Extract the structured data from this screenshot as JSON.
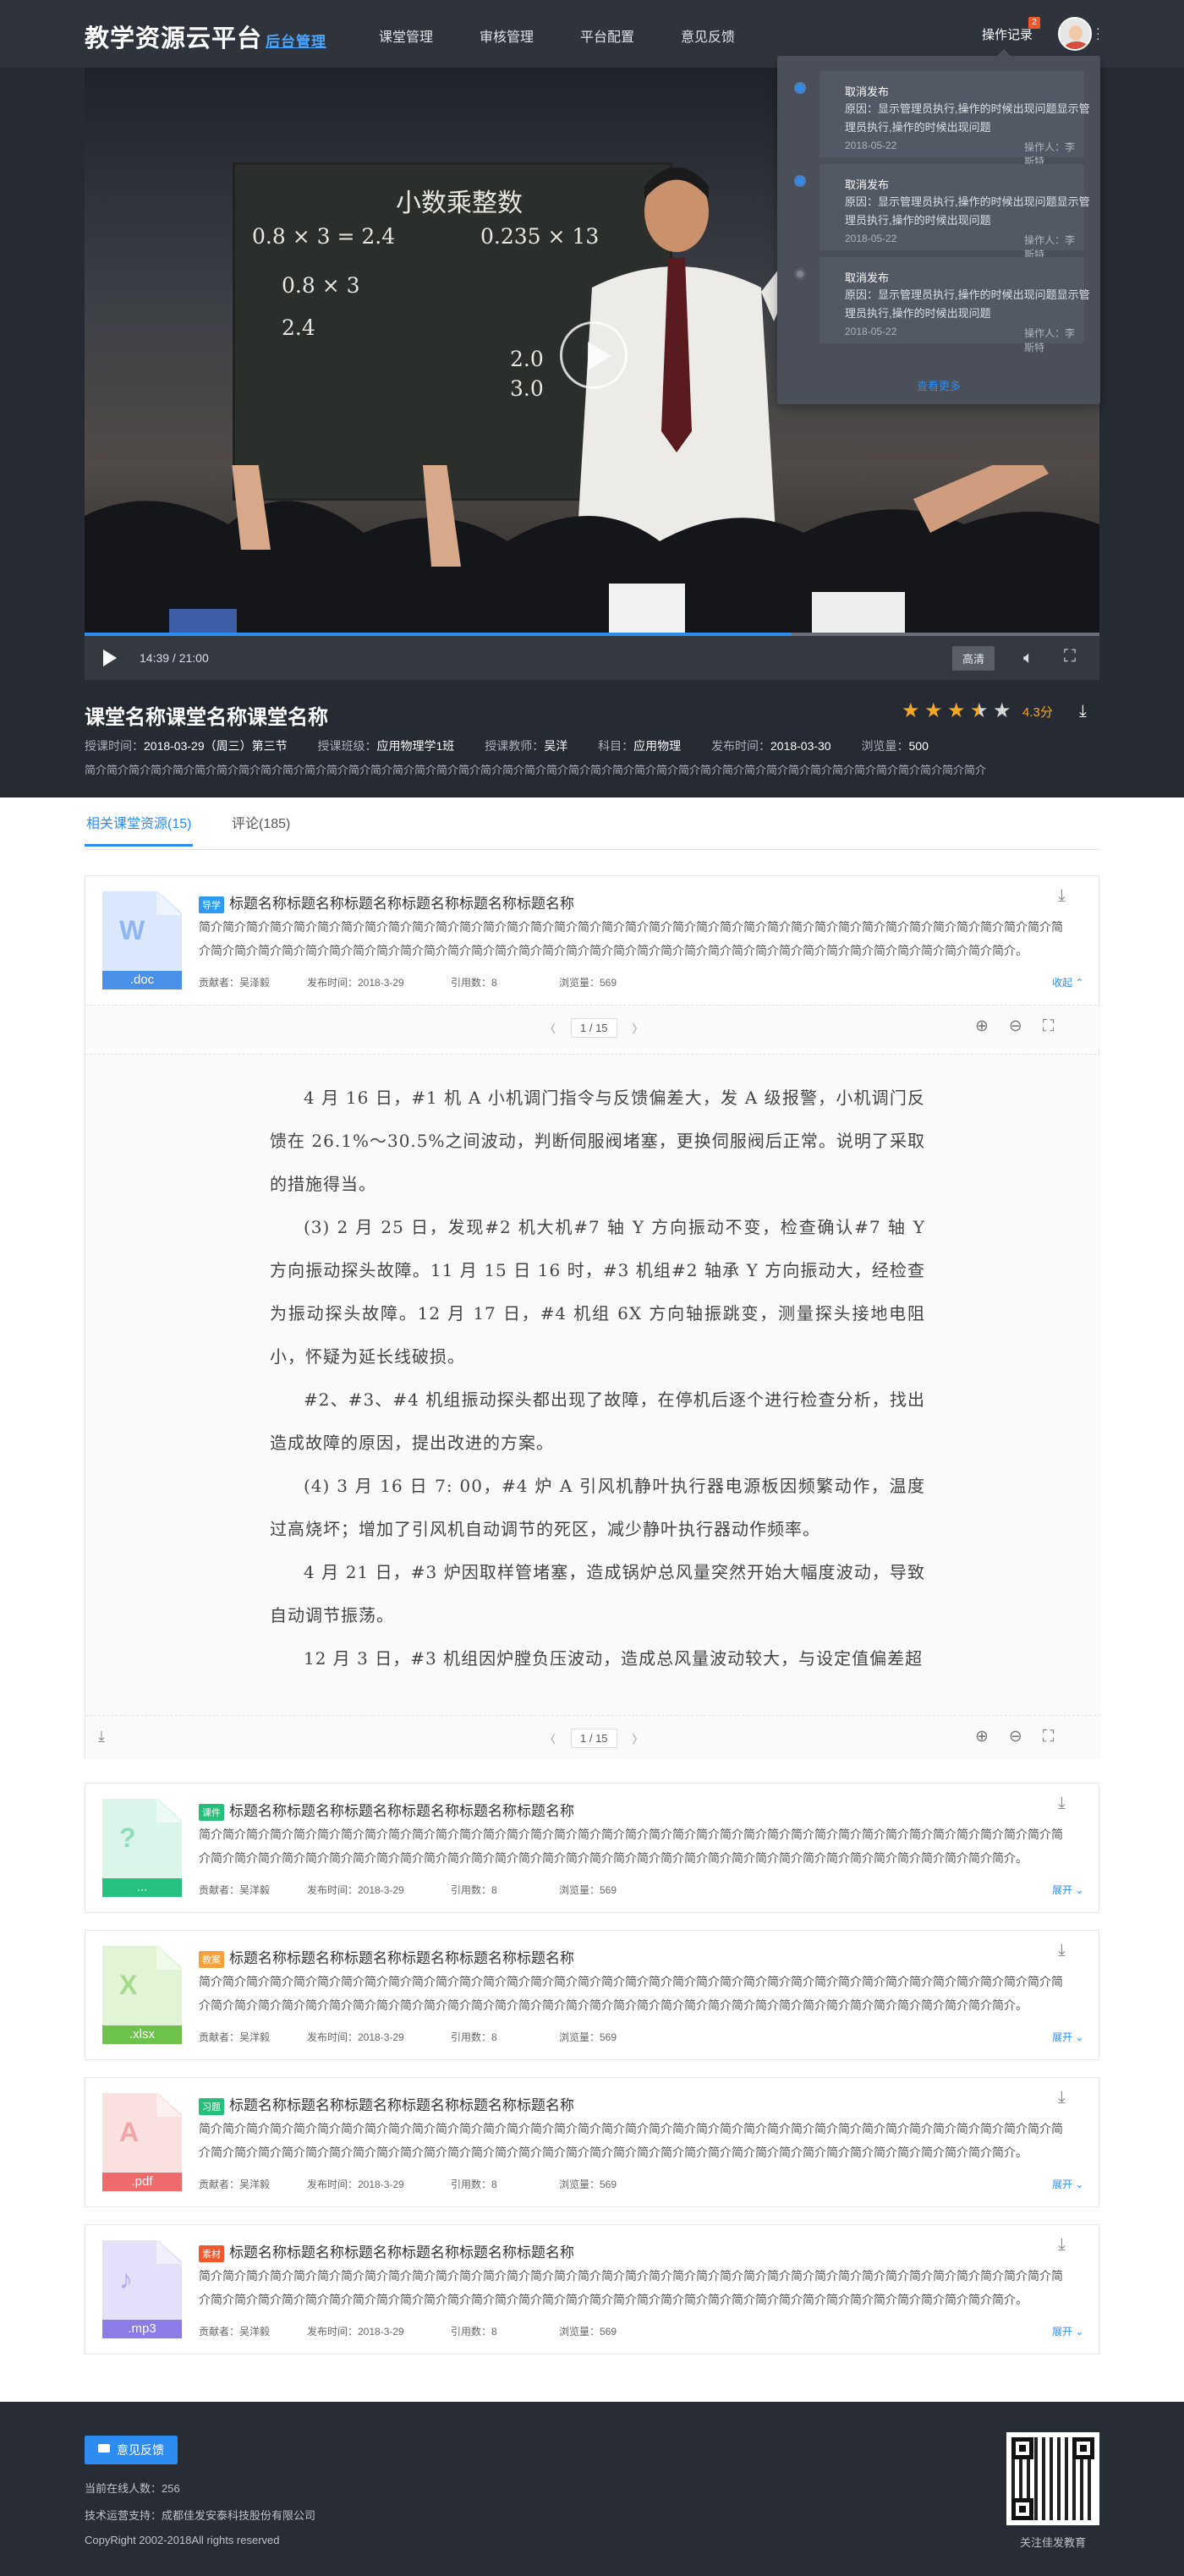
{
  "header": {
    "logo": "教学资源云平台",
    "logo_sub": "后台管理",
    "nav": [
      "课堂管理",
      "审核管理",
      "平台配置",
      "意见反馈"
    ],
    "op_record": "操作记录",
    "badge_count": "2"
  },
  "notifications": {
    "items": [
      {
        "title": "取消发布",
        "desc": "原因：显示管理员执行,操作的时候出现问题显示管理员执行,操作的时候出现问题",
        "date": "2018-05-22",
        "operator": "操作人：李斯特",
        "unread": true
      },
      {
        "title": "取消发布",
        "desc": "原因：显示管理员执行,操作的时候出现问题显示管理员执行,操作的时候出现问题",
        "date": "2018-05-22",
        "operator": "操作人：李斯特",
        "unread": true
      },
      {
        "title": "取消发布",
        "desc": "原因：显示管理员执行,操作的时候出现问题显示管理员执行,操作的时候出现问题",
        "date": "2018-05-22",
        "operator": "操作人：李斯特",
        "unread": false
      }
    ],
    "more": "查看更多"
  },
  "player": {
    "time": "14:39 / 21:00",
    "quality": "高清",
    "progress": 0.697,
    "board_title": "小数乘整数",
    "board_lines": [
      "0.8 × 3 = 2.4",
      "0.235 × 13",
      "0.8  × 3",
      "2.4",
      "2.0",
      "3.0"
    ]
  },
  "course": {
    "title": "课堂名称课堂名称课堂名称",
    "meta": [
      {
        "label": "授课时间：",
        "value": "2018-03-29（周三）第三节"
      },
      {
        "label": "授课班级：",
        "value": "应用物理学1班"
      },
      {
        "label": "授课教师：",
        "value": "吴洋"
      },
      {
        "label": "科目：",
        "value": "应用物理"
      },
      {
        "label": "发布时间：",
        "value": "2018-03-30"
      },
      {
        "label": "浏览量：",
        "value": "500"
      }
    ],
    "desc": "简介简介简介简介简介简介简介简介简介简介简介简介简介简介简介简介简介简介简介简介简介简介简介简介简介简介简介简介简介简介简介简介简介简介简介简介简介简介简介简介简介",
    "rating": 3.5,
    "score": "4.3分"
  },
  "tabs": [
    {
      "label": "相关课堂资源(15)",
      "active": true
    },
    {
      "label": "评论(185)",
      "active": false
    }
  ],
  "resources": [
    {
      "tag": "导学",
      "tag_color": "#2d9bf0",
      "ext": ".doc",
      "icon_color": "#dbe8fb",
      "ext_color": "#4a8fe8",
      "glyph": "W",
      "glyph_color": "#8fb7ef",
      "title": "标题名称标题名称标题名称标题名称标题名称标题名称",
      "desc": "简介简介简介简介简介简介简介简介简介简介简介简介简介简介简介简介简介简介简介简介简介简介简介简介简介简介简介简介简介简介简介简介简介简介简介简介简介简介简介简介简介简介简介简介简介简介简介简介简介简介简介简介简介简介简介简介简介简介简介简介简介简介简介简介简介简介简介简介简介简介简介。",
      "contributor": "贡献者：吴泽毅",
      "published": "发布时间：2018-3-29",
      "cites": "引用数：8",
      "views": "浏览量：569",
      "toggle": "收起 ⌃",
      "expanded": true
    },
    {
      "tag": "课件",
      "tag_color": "#24c07a",
      "ext": "...",
      "icon_color": "#dcf5ea",
      "ext_color": "#25c27f",
      "glyph": "?",
      "glyph_color": "#8fdcb9",
      "title": "标题名称标题名称标题名称标题名称标题名称标题名称",
      "desc": "简介简介简介简介简介简介简介简介简介简介简介简介简介简介简介简介简介简介简介简介简介简介简介简介简介简介简介简介简介简介简介简介简介简介简介简介简介简介简介简介简介简介简介简介简介简介简介简介简介简介简介简介简介简介简介简介简介简介简介简介简介简介简介简介简介简介简介简介简介简介简介。",
      "contributor": "贡献者：吴洋毅",
      "published": "发布时间：2018-3-29",
      "cites": "引用数：8",
      "views": "浏览量：569",
      "toggle": "展开 ⌄",
      "expanded": false
    },
    {
      "tag": "教案",
      "tag_color": "#f5a03a",
      "ext": ".xlsx",
      "icon_color": "#e1f4d6",
      "ext_color": "#6cc24a",
      "glyph": "X",
      "glyph_color": "#a5db8c",
      "title": "标题名称标题名称标题名称标题名称标题名称标题名称",
      "desc": "简介简介简介简介简介简介简介简介简介简介简介简介简介简介简介简介简介简介简介简介简介简介简介简介简介简介简介简介简介简介简介简介简介简介简介简介简介简介简介简介简介简介简介简介简介简介简介简介简介简介简介简介简介简介简介简介简介简介简介简介简介简介简介简介简介简介简介简介简介简介简介。",
      "contributor": "贡献者：吴洋毅",
      "published": "发布时间：2018-3-29",
      "cites": "引用数：8",
      "views": "浏览量：569",
      "toggle": "展开 ⌄",
      "expanded": false
    },
    {
      "tag": "习题",
      "tag_color": "#24c07a",
      "ext": ".pdf",
      "icon_color": "#fbe0e0",
      "ext_color": "#ef6b6b",
      "glyph": "A",
      "glyph_color": "#f3a6a6",
      "title": "标题名称标题名称标题名称标题名称标题名称标题名称",
      "desc": "简介简介简介简介简介简介简介简介简介简介简介简介简介简介简介简介简介简介简介简介简介简介简介简介简介简介简介简介简介简介简介简介简介简介简介简介简介简介简介简介简介简介简介简介简介简介简介简介简介简介简介简介简介简介简介简介简介简介简介简介简介简介简介简介简介简介简介简介简介简介简介。",
      "contributor": "贡献者：吴洋毅",
      "published": "发布时间：2018-3-29",
      "cites": "引用数：8",
      "views": "浏览量：569",
      "toggle": "展开 ⌄",
      "expanded": false
    },
    {
      "tag": "素材",
      "tag_color": "#f0582b",
      "ext": ".mp3",
      "icon_color": "#e4e0fa",
      "ext_color": "#8c7ce8",
      "glyph": "♪",
      "glyph_color": "#b4a8ef",
      "title": "标题名称标题名称标题名称标题名称标题名称标题名称",
      "desc": "简介简介简介简介简介简介简介简介简介简介简介简介简介简介简介简介简介简介简介简介简介简介简介简介简介简介简介简介简介简介简介简介简介简介简介简介简介简介简介简介简介简介简介简介简介简介简介简介简介简介简介简介简介简介简介简介简介简介简介简介简介简介简介简介简介简介简介简介简介简介简介。",
      "contributor": "贡献者：吴洋毅",
      "published": "发布时间：2018-3-29",
      "cites": "引用数：8",
      "views": "浏览量：569",
      "toggle": "展开 ⌄",
      "expanded": false
    }
  ],
  "viewer": {
    "page": "1 / 15",
    "paragraphs": [
      "4 月 16 日，#1 机 A 小机调门指令与反馈偏差大，发 A 级报警，小机调门反馈在 26.1%～30.5%之间波动，判断伺服阀堵塞，更换伺服阀后正常。说明了采取的措施得当。",
      "(3) 2 月 25 日，发现#2 机大机#7 轴 Y 方向振动不变，检查确认#7 轴 Y 方向振动探头故障。11 月 15 日 16 时，#3 机组#2 轴承 Y 方向振动大，经检查为振动探头故障。12 月 17 日，#4 机组 6X 方向轴振跳变，测量探头接地电阻小，怀疑为延长线破损。",
      "#2、#3、#4 机组振动探头都出现了故障，在停机后逐个进行检查分析，找出造成故障的原因，提出改进的方案。",
      "(4) 3 月 16 日 7: 00，#4 炉 A 引风机静叶执行器电源板因频繁动作，温度过高烧坏；增加了引风机自动调节的死区，减少静叶执行器动作频率。",
      "4 月 21 日，#3 炉因取样管堵塞，造成锅炉总风量突然开始大幅度波动，导致自动调节振荡。",
      "12 月 3 日，#3 机组因炉膛负压波动，造成总风量波动较大，与设定值偏差超"
    ]
  },
  "footer": {
    "feedback": "意见反馈",
    "online": "当前在线人数：256",
    "support": "技术运营支持：成都佳发安泰科技股份有限公司",
    "copyright": "CopyRight 2002-2018All rights reserved",
    "qr_caption": "关注佳发教育"
  }
}
